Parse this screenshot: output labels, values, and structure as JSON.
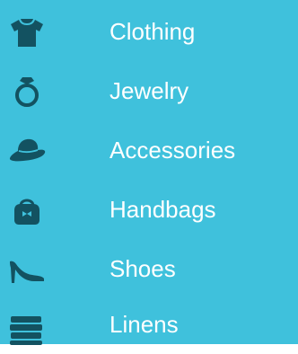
{
  "theme": {
    "background": "#3fc1dc",
    "text_color": "#ffffff",
    "icon_color": "#135261"
  },
  "menu": {
    "items": [
      {
        "label": "Clothing",
        "icon": "tshirt-icon"
      },
      {
        "label": "Jewelry",
        "icon": "ring-icon"
      },
      {
        "label": "Accessories",
        "icon": "hat-icon"
      },
      {
        "label": "Handbags",
        "icon": "handbag-icon"
      },
      {
        "label": "Shoes",
        "icon": "high-heel-icon"
      },
      {
        "label": "Linens",
        "icon": "folded-linens-icon"
      }
    ]
  }
}
